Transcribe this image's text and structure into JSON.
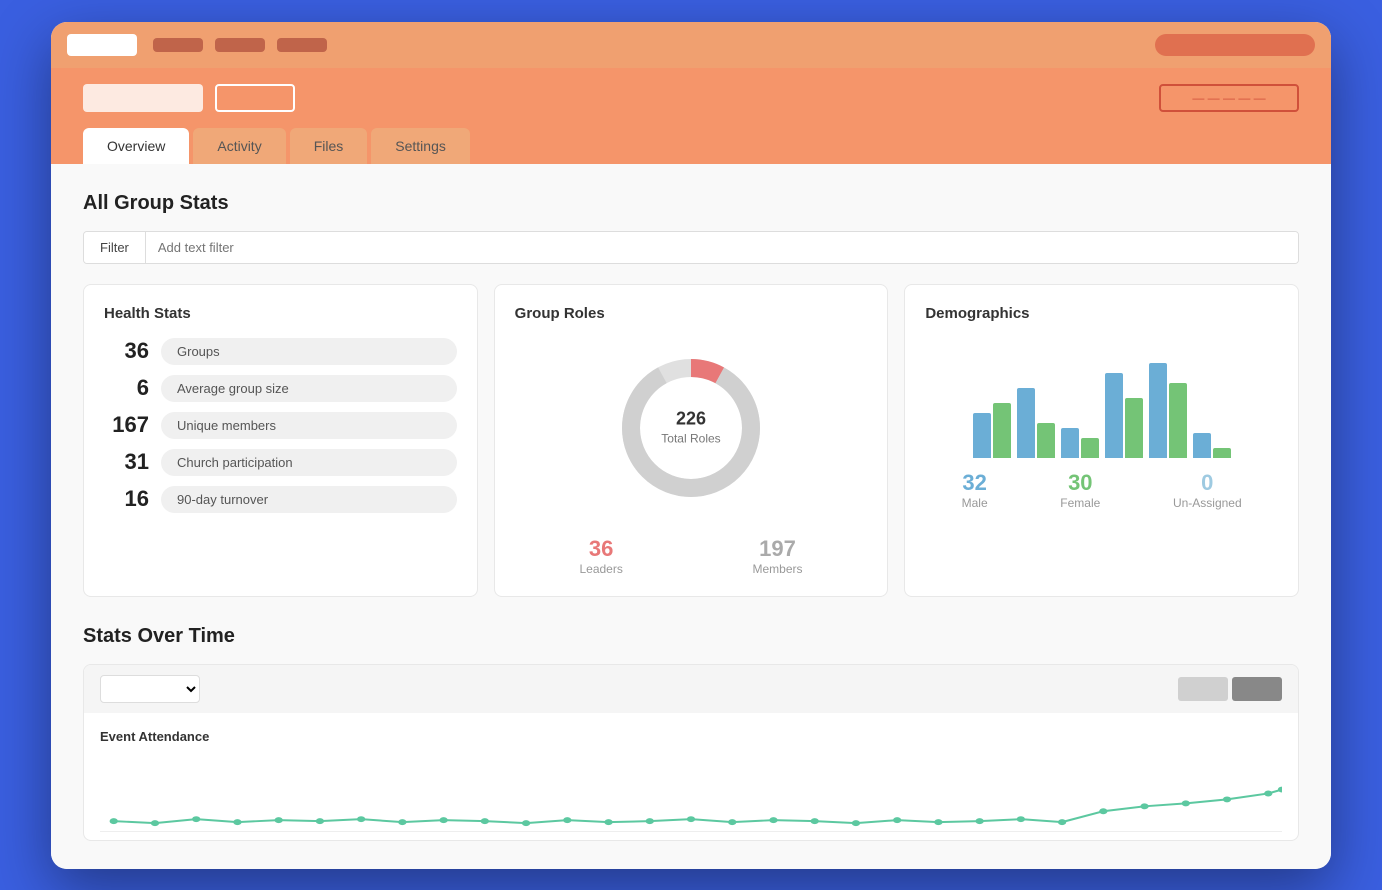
{
  "browser": {
    "address_bar": ""
  },
  "header": {
    "logo_text": "",
    "btn_outline_label": "",
    "btn_right_label": "— — — — —"
  },
  "tabs": [
    {
      "id": "overview",
      "label": "Overview",
      "active": true
    },
    {
      "id": "activity",
      "label": "Activity",
      "active": false
    },
    {
      "id": "files",
      "label": "Files",
      "active": false
    },
    {
      "id": "settings",
      "label": "Settings",
      "active": false
    }
  ],
  "page": {
    "title": "All Group Stats"
  },
  "filter": {
    "button_label": "Filter",
    "input_placeholder": "Add text filter"
  },
  "health_stats": {
    "title": "Health Stats",
    "rows": [
      {
        "number": "36",
        "label": "Groups"
      },
      {
        "number": "6",
        "label": "Average group size"
      },
      {
        "number": "167",
        "label": "Unique members"
      },
      {
        "number": "31",
        "label": "Church participation"
      },
      {
        "number": "16",
        "label": "90-day turnover"
      }
    ]
  },
  "group_roles": {
    "title": "Group Roles",
    "total_number": "226",
    "total_label": "Total Roles",
    "leaders_number": "36",
    "leaders_label": "Leaders",
    "members_number": "197",
    "members_label": "Members"
  },
  "demographics": {
    "title": "Demographics",
    "male_number": "32",
    "male_label": "Male",
    "female_number": "30",
    "female_label": "Female",
    "unassigned_number": "0",
    "unassigned_label": "Un-Assigned",
    "bars": [
      {
        "blue": 45,
        "green": 55
      },
      {
        "blue": 70,
        "green": 35
      },
      {
        "blue": 30,
        "green": 20
      },
      {
        "blue": 85,
        "green": 60
      },
      {
        "blue": 95,
        "green": 75
      },
      {
        "blue": 25,
        "green": 10
      }
    ]
  },
  "stats_over_time": {
    "title": "Stats Over Time",
    "dropdown_value": "",
    "chart_label": "Event Attendance",
    "line_points": "10,70 40,72 70,68 100,71 130,69 160,70 190,68 220,71 250,69 280,70 310,72 340,69 370,71 400,70 430,68 460,71 490,69 520,70 550,72 580,69 610,71 640,70 670,68 700,71 730,60 760,65 790,62 820,58 850,55 860,52"
  }
}
